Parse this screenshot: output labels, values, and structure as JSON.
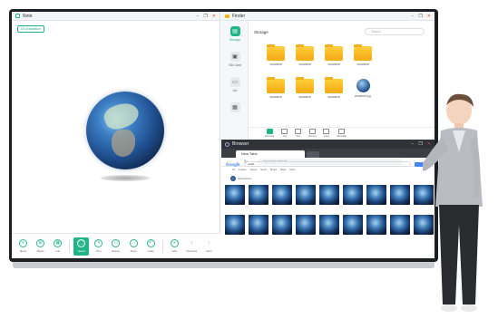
{
  "note": {
    "title": "Note",
    "pill": "Ch Annotation",
    "toolbar": [
      {
        "label": "Menu",
        "glyph": "≡"
      },
      {
        "label": "Share",
        "glyph": "⊞"
      },
      {
        "label": "List",
        "glyph": "▦"
      },
      {
        "label": "Select",
        "glyph": "⬚"
      },
      {
        "label": "Pen",
        "glyph": "✎"
      },
      {
        "label": "Eraser",
        "glyph": "◇"
      },
      {
        "label": "More",
        "glyph": "…"
      },
      {
        "label": "Undo",
        "glyph": "↶"
      },
      {
        "label": "Add",
        "glyph": "+"
      },
      {
        "label": "Previous",
        "glyph": "‹"
      },
      {
        "label": "Next",
        "glyph": "›"
      }
    ]
  },
  "finder": {
    "title": "Finder",
    "path": "Storage",
    "search_placeholder": "Search",
    "sidebar": [
      {
        "label": "Storage",
        "glyph": "▤"
      },
      {
        "label": "SD Card",
        "glyph": "▣"
      },
      {
        "label": "UV",
        "glyph": "▭"
      },
      {
        "label": "",
        "glyph": "▦"
      }
    ],
    "folders": [
      "20190516",
      "20190516",
      "20190516",
      "20190516",
      "20190516",
      "20190516",
      "20190516"
    ],
    "image_file": "20190516.jpg",
    "bottom_bar": [
      "Personal",
      "List",
      "Sort",
      "Recent",
      "Copy",
      "Move/file"
    ]
  },
  "browser": {
    "title": "Browser",
    "tab_label": "New Tabs",
    "url_placeholder": "Input the website",
    "search_brand": "Google",
    "query": "earth",
    "search_tabs": [
      "All",
      "Images",
      "Videos",
      "News",
      "Books",
      "Maps",
      "More"
    ],
    "result_label": "Chromosome"
  },
  "colors": {
    "accent": "#20b486",
    "folder": "#f5b41e",
    "close": "#e0463b"
  }
}
